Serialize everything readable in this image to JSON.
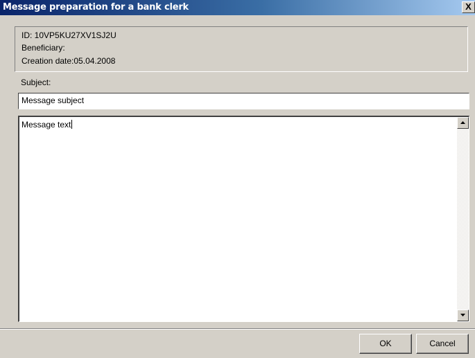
{
  "window": {
    "title": "Message preparation for a bank clerk",
    "close_label": "X"
  },
  "info": {
    "id_line": "ID: 10VP5KU27XV1SJ2U",
    "beneficiary_line": "Beneficiary:",
    "creation_line": "Creation date:05.04.2008"
  },
  "subject": {
    "label": "Subject:",
    "value": "Message subject"
  },
  "message": {
    "value": "Message text"
  },
  "buttons": {
    "ok": "OK",
    "cancel": "Cancel"
  },
  "colors": {
    "titlebar_start": "#0a246a",
    "titlebar_end": "#a6caf0",
    "dialog_face": "#d4d0c8"
  },
  "icons": [
    "close-icon",
    "scroll-up-icon",
    "scroll-down-icon"
  ]
}
